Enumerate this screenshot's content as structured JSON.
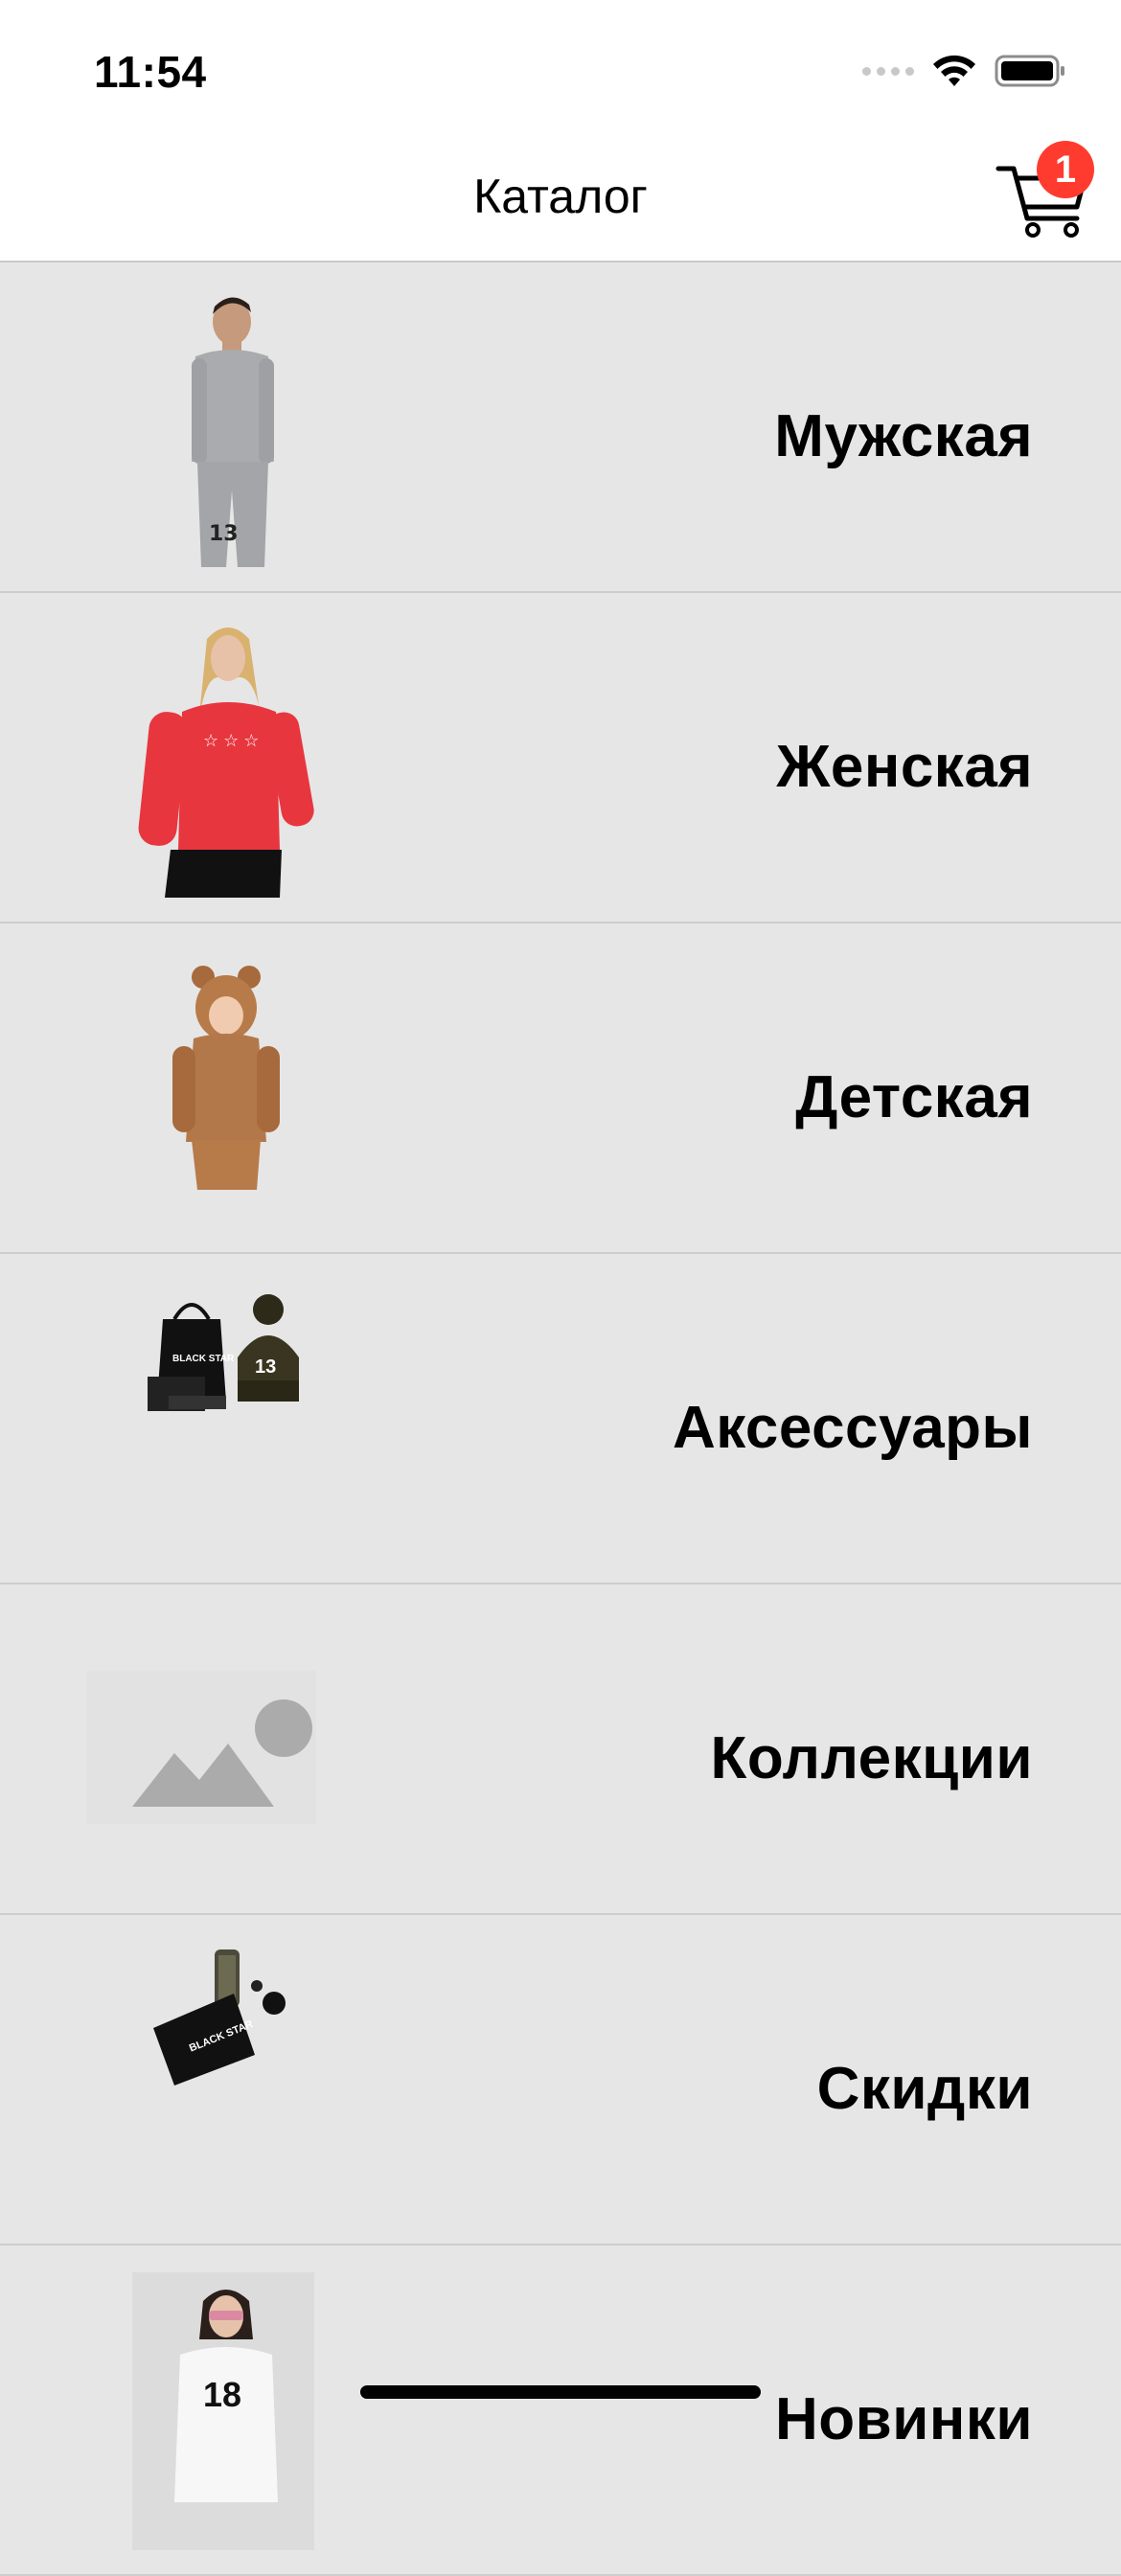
{
  "status_bar": {
    "time": "11:54"
  },
  "nav": {
    "title": "Каталог",
    "cart_badge": "1"
  },
  "categories": [
    {
      "label": "Мужская",
      "thumbnail": "men-tracksuit-photo"
    },
    {
      "label": "Женская",
      "thumbnail": "women-red-sweatshirt-photo"
    },
    {
      "label": "Детская",
      "thumbnail": "kids-bear-hoodie-photo"
    },
    {
      "label": "Аксессуары",
      "thumbnail": "accessories-bag-beanie-photo"
    },
    {
      "label": "Коллекции",
      "thumbnail": "image-placeholder-icon"
    },
    {
      "label": "Скидки",
      "thumbnail": "sale-accessories-photo"
    },
    {
      "label": "Новинки",
      "thumbnail": "new-arrivals-tshirt-photo"
    }
  ],
  "colors": {
    "badge": "#ff3b30",
    "row_background": "#e6e6e6",
    "separator": "#cdcdcd"
  }
}
